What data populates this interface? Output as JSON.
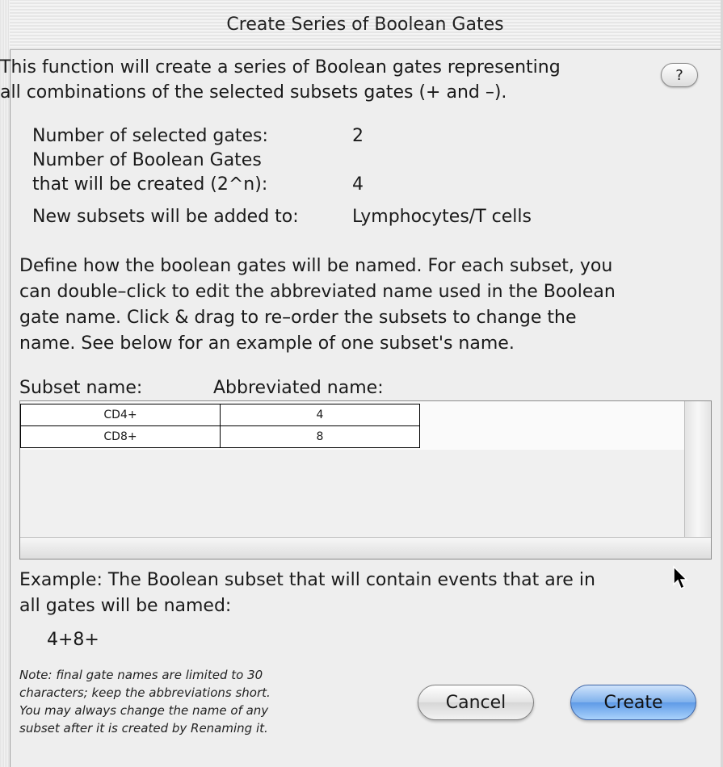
{
  "window": {
    "title": "Create Series of Boolean Gates"
  },
  "intro": {
    "line1": "This function will create a series of Boolean gates representing",
    "line2": "all combinations of the selected subsets gates (+ and –).",
    "help_label": "?"
  },
  "info": {
    "selected_label": "Number of selected gates:",
    "selected_value": "2",
    "boolean_label_line1": "Number of Boolean Gates",
    "boolean_label_line2": "that will be created (2^n):",
    "boolean_value": "4",
    "added_label": "New subsets will be added to:",
    "added_value": "Lymphocytes/T cells"
  },
  "define": {
    "line1": "Define how the boolean gates will be named.  For each subset, you",
    "line2": "can double–click to edit the abbreviated name used in the Boolean",
    "line3": "gate name.  Click & drag to re–order the subsets to change the",
    "line4": "name.  See below for an example of one subset's name."
  },
  "table": {
    "col_subset": "Subset name:",
    "col_abbrev": "Abbreviated name:",
    "rows": [
      {
        "subset": "CD4+",
        "abbrev": "4"
      },
      {
        "subset": "CD8+",
        "abbrev": "8"
      }
    ]
  },
  "example": {
    "line1": "Example: The Boolean subset that will contain events that are in",
    "line2": "all gates will be named:",
    "value": "4+8+"
  },
  "note": {
    "line1": "Note: final gate names are limited to 30",
    "line2": "characters; keep the abbreviations short.",
    "line3": "You may always change the name of any",
    "line4": "subset after it is created by Renaming it."
  },
  "buttons": {
    "cancel": "Cancel",
    "create": "Create"
  },
  "colors": {
    "default_button": "#6aa6ea",
    "background": "#eeeeee"
  }
}
